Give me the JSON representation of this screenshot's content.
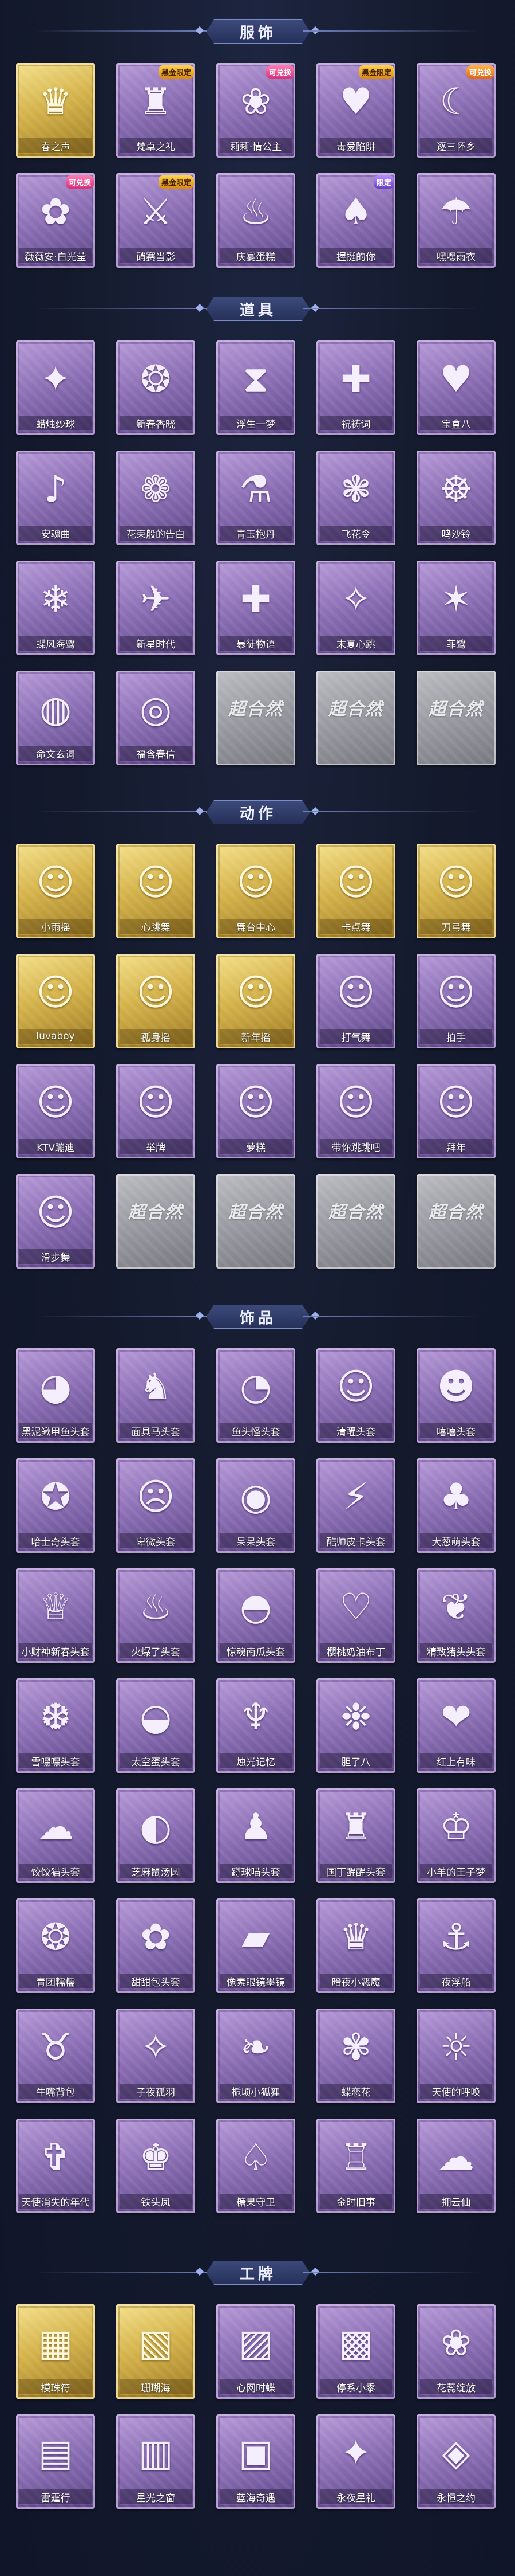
{
  "sections": [
    {
      "id": "costume",
      "title": "服饰",
      "items": [
        {
          "label": "春之声",
          "icon": "portrait-icon",
          "glyph": "♛",
          "rarity": "gold",
          "badge": ""
        },
        {
          "label": "梵卓之礼",
          "icon": "portrait-icon",
          "glyph": "♜",
          "rarity": "purple",
          "badge": "黑金限定",
          "badge_style": "gold-b"
        },
        {
          "label": "莉莉·情公主",
          "icon": "portrait-icon",
          "glyph": "❀",
          "rarity": "purple",
          "badge": "可兑换",
          "badge_style": "pink-b"
        },
        {
          "label": "毒爱陷阱",
          "icon": "portrait-icon",
          "glyph": "♥",
          "rarity": "purple",
          "badge": "黑金限定",
          "badge_style": "gold-b"
        },
        {
          "label": "逐三怀乡",
          "icon": "portrait-icon",
          "glyph": "☾",
          "rarity": "purple",
          "badge": "可兑换",
          "badge_style": "orange-b"
        },
        {
          "label": "薇薇安·白光莹",
          "icon": "portrait-icon",
          "glyph": "✿",
          "rarity": "purple",
          "badge": "可兑换",
          "badge_style": "pink-b"
        },
        {
          "label": "硝赛当影",
          "icon": "portrait-icon",
          "glyph": "⚔",
          "rarity": "purple",
          "badge": "黑金限定",
          "badge_style": "gold-b"
        },
        {
          "label": "庆宴蛋糕",
          "icon": "portrait-icon",
          "glyph": "♨",
          "rarity": "purple",
          "badge": ""
        },
        {
          "label": "握挺的你",
          "icon": "portrait-icon",
          "glyph": "♠",
          "rarity": "purple",
          "badge": "限定",
          "badge_style": "purple-b"
        },
        {
          "label": "嘿嘿雨衣",
          "icon": "portrait-icon",
          "glyph": "☂",
          "rarity": "purple",
          "badge": ""
        }
      ]
    },
    {
      "id": "props",
      "title": "道具",
      "items": [
        {
          "label": "蜡烛纱球",
          "icon": "prop-icon",
          "glyph": "✦",
          "rarity": "purple"
        },
        {
          "label": "新春香晓",
          "icon": "prop-icon",
          "glyph": "❂",
          "rarity": "purple"
        },
        {
          "label": "浮生一梦",
          "icon": "prop-icon",
          "glyph": "⧗",
          "rarity": "purple"
        },
        {
          "label": "祝祷词",
          "icon": "prop-icon",
          "glyph": "✚",
          "rarity": "purple"
        },
        {
          "label": "宝盒八",
          "icon": "prop-icon",
          "glyph": "♥",
          "rarity": "purple"
        },
        {
          "label": "安魂曲",
          "icon": "prop-icon",
          "glyph": "♪",
          "rarity": "purple"
        },
        {
          "label": "花束般的告白",
          "icon": "prop-icon",
          "glyph": "❁",
          "rarity": "purple"
        },
        {
          "label": "青玉抱丹",
          "icon": "prop-icon",
          "glyph": "⚗",
          "rarity": "purple"
        },
        {
          "label": "飞花令",
          "icon": "prop-icon",
          "glyph": "❃",
          "rarity": "purple"
        },
        {
          "label": "鸣沙铃",
          "icon": "prop-icon",
          "glyph": "☸",
          "rarity": "purple"
        },
        {
          "label": "蝶风海鹭",
          "icon": "prop-icon",
          "glyph": "❄",
          "rarity": "purple"
        },
        {
          "label": "新星时代",
          "icon": "prop-icon",
          "glyph": "✈",
          "rarity": "purple"
        },
        {
          "label": "暴徒物语",
          "icon": "prop-icon",
          "glyph": "✚",
          "rarity": "purple"
        },
        {
          "label": "末夏心跳",
          "icon": "prop-icon",
          "glyph": "✧",
          "rarity": "purple"
        },
        {
          "label": "菲鹭",
          "icon": "prop-icon",
          "glyph": "✶",
          "rarity": "purple"
        },
        {
          "label": "命文玄词",
          "icon": "prop-icon",
          "glyph": "◍",
          "rarity": "purple"
        },
        {
          "label": "福含春信",
          "icon": "prop-icon",
          "glyph": "◎",
          "rarity": "purple"
        },
        {
          "label": "",
          "icon": "locked-icon",
          "glyph": "超合然",
          "rarity": "locked"
        },
        {
          "label": "",
          "icon": "locked-icon",
          "glyph": "超合然",
          "rarity": "locked"
        },
        {
          "label": "",
          "icon": "locked-icon",
          "glyph": "超合然",
          "rarity": "locked"
        }
      ]
    },
    {
      "id": "actions",
      "title": "动作",
      "items": [
        {
          "label": "小雨摇",
          "icon": "pose-icon",
          "glyph": "☺",
          "rarity": "gold"
        },
        {
          "label": "心跳舞",
          "icon": "pose-icon",
          "glyph": "☺",
          "rarity": "gold"
        },
        {
          "label": "舞台中心",
          "icon": "pose-icon",
          "glyph": "☺",
          "rarity": "gold"
        },
        {
          "label": "卡点舞",
          "icon": "pose-icon",
          "glyph": "☺",
          "rarity": "gold"
        },
        {
          "label": "刀弓舞",
          "icon": "pose-icon",
          "glyph": "☺",
          "rarity": "gold"
        },
        {
          "label": "luvaboy",
          "icon": "pose-icon",
          "glyph": "☺",
          "rarity": "gold"
        },
        {
          "label": "孤身摇",
          "icon": "pose-icon",
          "glyph": "☺",
          "rarity": "gold"
        },
        {
          "label": "新年摇",
          "icon": "pose-icon",
          "glyph": "☺",
          "rarity": "gold"
        },
        {
          "label": "打气舞",
          "icon": "pose-icon",
          "glyph": "☺",
          "rarity": "purple"
        },
        {
          "label": "拍手",
          "icon": "pose-icon",
          "glyph": "☺",
          "rarity": "purple"
        },
        {
          "label": "KTV蹦迪",
          "icon": "pose-icon",
          "glyph": "☺",
          "rarity": "purple"
        },
        {
          "label": "举牌",
          "icon": "pose-icon",
          "glyph": "☺",
          "rarity": "purple"
        },
        {
          "label": "萝糕",
          "icon": "pose-icon",
          "glyph": "☺",
          "rarity": "purple"
        },
        {
          "label": "带你跳跳吧",
          "icon": "pose-icon",
          "glyph": "☺",
          "rarity": "purple"
        },
        {
          "label": "拜年",
          "icon": "pose-icon",
          "glyph": "☺",
          "rarity": "purple"
        },
        {
          "label": "滑步舞",
          "icon": "pose-icon",
          "glyph": "☺",
          "rarity": "purple"
        },
        {
          "label": "",
          "icon": "locked-icon",
          "glyph": "超合然",
          "rarity": "locked"
        },
        {
          "label": "",
          "icon": "locked-icon",
          "glyph": "超合然",
          "rarity": "locked"
        },
        {
          "label": "",
          "icon": "locked-icon",
          "glyph": "超合然",
          "rarity": "locked"
        },
        {
          "label": "",
          "icon": "locked-icon",
          "glyph": "超合然",
          "rarity": "locked"
        }
      ]
    },
    {
      "id": "accessories",
      "title": "饰品",
      "items": [
        {
          "label": "黑泥鳅甲鱼头套",
          "icon": "headgear-icon",
          "glyph": "◕",
          "rarity": "purple"
        },
        {
          "label": "面具马头套",
          "icon": "headgear-icon",
          "glyph": "♞",
          "rarity": "purple"
        },
        {
          "label": "鱼头怪头套",
          "icon": "headgear-icon",
          "glyph": "◔",
          "rarity": "purple"
        },
        {
          "label": "清醒头套",
          "icon": "headgear-icon",
          "glyph": "☺",
          "rarity": "purple"
        },
        {
          "label": "嘻嘻头套",
          "icon": "headgear-icon",
          "glyph": "☻",
          "rarity": "purple"
        },
        {
          "label": "哈士奇头套",
          "icon": "headgear-icon",
          "glyph": "✪",
          "rarity": "purple"
        },
        {
          "label": "卑微头套",
          "icon": "headgear-icon",
          "glyph": "☹",
          "rarity": "purple"
        },
        {
          "label": "呆呆头套",
          "icon": "headgear-icon",
          "glyph": "◉",
          "rarity": "purple"
        },
        {
          "label": "酷帅皮卡头套",
          "icon": "headgear-icon",
          "glyph": "⚡",
          "rarity": "purple"
        },
        {
          "label": "大葱萌头套",
          "icon": "headgear-icon",
          "glyph": "♣",
          "rarity": "purple"
        },
        {
          "label": "小财神新春头套",
          "icon": "headgear-icon",
          "glyph": "♕",
          "rarity": "purple"
        },
        {
          "label": "火爆了头套",
          "icon": "headgear-icon",
          "glyph": "♨",
          "rarity": "purple"
        },
        {
          "label": "惊魂南瓜头套",
          "icon": "headgear-icon",
          "glyph": "◓",
          "rarity": "purple"
        },
        {
          "label": "樱桃奶油布丁",
          "icon": "headgear-icon",
          "glyph": "♡",
          "rarity": "purple"
        },
        {
          "label": "精致猪头头套",
          "icon": "headgear-icon",
          "glyph": "❦",
          "rarity": "purple"
        },
        {
          "label": "雪嘿嘿头套",
          "icon": "headgear-icon",
          "glyph": "❆",
          "rarity": "purple"
        },
        {
          "label": "太空蛋头套",
          "icon": "headgear-icon",
          "glyph": "◒",
          "rarity": "purple"
        },
        {
          "label": "烛光记忆",
          "icon": "headgear-icon",
          "glyph": "♆",
          "rarity": "purple"
        },
        {
          "label": "胆了八",
          "icon": "headgear-icon",
          "glyph": "❉",
          "rarity": "purple"
        },
        {
          "label": "红上有味",
          "icon": "headgear-icon",
          "glyph": "❤",
          "rarity": "purple"
        },
        {
          "label": "饺饺猫头套",
          "icon": "headgear-icon",
          "glyph": "☁",
          "rarity": "purple"
        },
        {
          "label": "芝麻鼠汤圆",
          "icon": "headgear-icon",
          "glyph": "◐",
          "rarity": "purple"
        },
        {
          "label": "蹲球喵头套",
          "icon": "headgear-icon",
          "glyph": "♟",
          "rarity": "purple"
        },
        {
          "label": "国丁醒醒头套",
          "icon": "headgear-icon",
          "glyph": "♜",
          "rarity": "purple"
        },
        {
          "label": "小羊的王子梦",
          "icon": "headgear-icon",
          "glyph": "♔",
          "rarity": "purple"
        },
        {
          "label": "青团糯糯",
          "icon": "headgear-icon",
          "glyph": "❂",
          "rarity": "purple"
        },
        {
          "label": "甜甜包头套",
          "icon": "headgear-icon",
          "glyph": "✿",
          "rarity": "purple"
        },
        {
          "label": "像素眼镜墨镜",
          "icon": "headgear-icon",
          "glyph": "▰",
          "rarity": "purple"
        },
        {
          "label": "暗夜小恶魔",
          "icon": "headgear-icon",
          "glyph": "♛",
          "rarity": "purple"
        },
        {
          "label": "夜浮船",
          "icon": "headgear-icon",
          "glyph": "⚓",
          "rarity": "purple"
        },
        {
          "label": "牛嘴背包",
          "icon": "headgear-icon",
          "glyph": "♉",
          "rarity": "purple"
        },
        {
          "label": "子夜孤羽",
          "icon": "headgear-icon",
          "glyph": "✧",
          "rarity": "purple"
        },
        {
          "label": "栀顷小狐狸",
          "icon": "headgear-icon",
          "glyph": "❧",
          "rarity": "purple"
        },
        {
          "label": "蝶恋花",
          "icon": "headgear-icon",
          "glyph": "✾",
          "rarity": "purple"
        },
        {
          "label": "天使的呼唤",
          "icon": "headgear-icon",
          "glyph": "☼",
          "rarity": "purple"
        },
        {
          "label": "天使消失的年代",
          "icon": "headgear-icon",
          "glyph": "✞",
          "rarity": "purple"
        },
        {
          "label": "铁头凤",
          "icon": "headgear-icon",
          "glyph": "♚",
          "rarity": "purple"
        },
        {
          "label": "糖果守卫",
          "icon": "headgear-icon",
          "glyph": "♤",
          "rarity": "purple"
        },
        {
          "label": "金时旧事",
          "icon": "headgear-icon",
          "glyph": "♖",
          "rarity": "purple"
        },
        {
          "label": "拥云仙",
          "icon": "headgear-icon",
          "glyph": "☁",
          "rarity": "purple"
        }
      ]
    },
    {
      "id": "cards",
      "title": "工牌",
      "items": [
        {
          "label": "模珠符",
          "icon": "card-icon",
          "glyph": "▦",
          "rarity": "gold"
        },
        {
          "label": "珊瑚海",
          "icon": "card-icon",
          "glyph": "▧",
          "rarity": "gold"
        },
        {
          "label": "心网时蝶",
          "icon": "card-icon",
          "glyph": "▨",
          "rarity": "purple"
        },
        {
          "label": "停系小黍",
          "icon": "card-icon",
          "glyph": "▩",
          "rarity": "purple"
        },
        {
          "label": "花蕊绽放",
          "icon": "card-icon",
          "glyph": "❀",
          "rarity": "purple"
        },
        {
          "label": "雷霆行",
          "icon": "card-icon",
          "glyph": "▤",
          "rarity": "purple"
        },
        {
          "label": "星光之窗",
          "icon": "card-icon",
          "glyph": "▥",
          "rarity": "purple"
        },
        {
          "label": "蓝海奇遇",
          "icon": "card-icon",
          "glyph": "▣",
          "rarity": "purple"
        },
        {
          "label": "永夜星礼",
          "icon": "card-icon",
          "glyph": "✦",
          "rarity": "purple"
        },
        {
          "label": "永恒之约",
          "icon": "card-icon",
          "glyph": "◈",
          "rarity": "purple"
        }
      ]
    }
  ]
}
